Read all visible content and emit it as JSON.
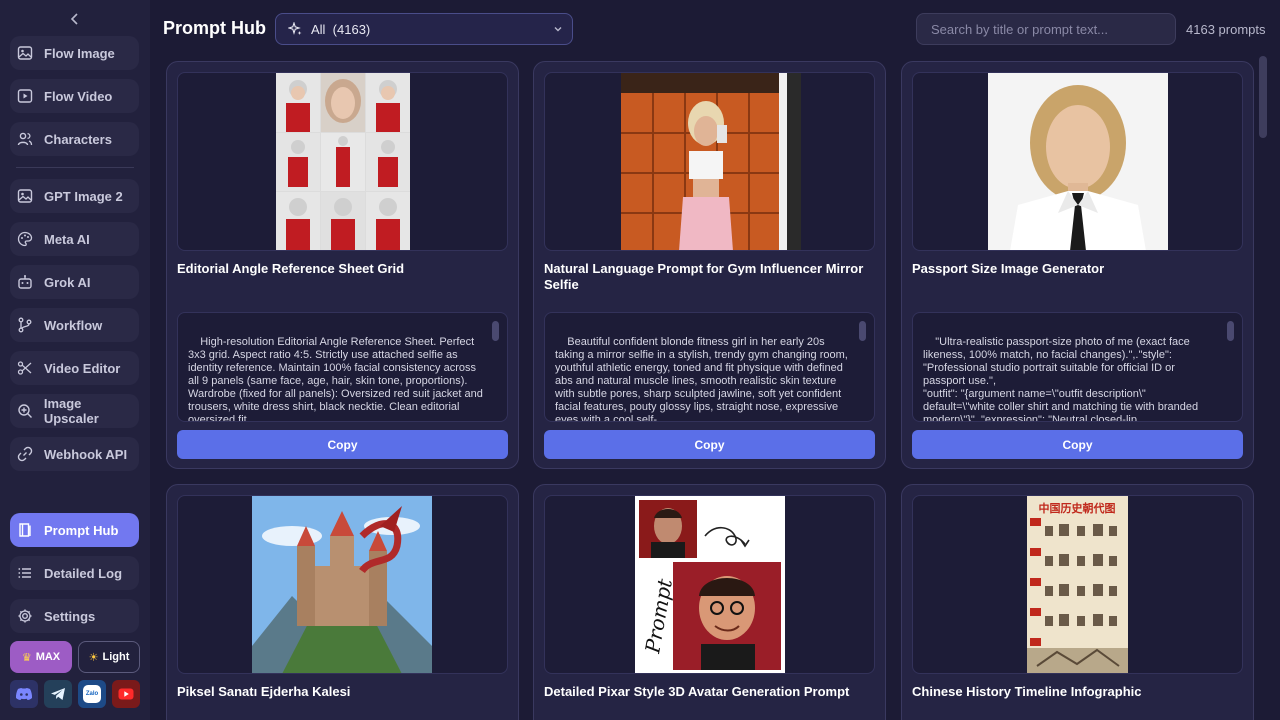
{
  "sidebar": {
    "items": [
      {
        "label": "Flow Image",
        "icon": "image-icon"
      },
      {
        "label": "Flow Video",
        "icon": "play-icon"
      },
      {
        "label": "Characters",
        "icon": "users-icon"
      },
      {
        "label": "GPT Image 2",
        "icon": "image-icon"
      },
      {
        "label": "Meta AI",
        "icon": "palette-icon"
      },
      {
        "label": "Grok AI",
        "icon": "bot-icon"
      },
      {
        "label": "Workflow",
        "icon": "workflow-icon"
      },
      {
        "label": "Video Editor",
        "icon": "scissors-icon"
      },
      {
        "label": "Image Upscaler",
        "icon": "zoom-in-icon"
      },
      {
        "label": "Webhook API",
        "icon": "link-icon"
      }
    ],
    "bottom_items": [
      {
        "label": "Prompt Hub",
        "icon": "book-icon",
        "active": true
      },
      {
        "label": "Detailed Log",
        "icon": "list-icon"
      },
      {
        "label": "Settings",
        "icon": "gear-icon"
      }
    ],
    "max_label": "MAX",
    "theme_label": "Light",
    "socials": [
      "discord-icon",
      "telegram-icon",
      "zalo-icon",
      "youtube-icon"
    ],
    "active_color": "#7278f0"
  },
  "header": {
    "title": "Prompt Hub",
    "filter_value": "All  (4163)",
    "search_placeholder": "Search by title or prompt text...",
    "count": "4163 prompts"
  },
  "cards": [
    {
      "title": "Editorial Angle Reference Sheet Grid",
      "prompt": "High-resolution Editorial Angle Reference Sheet. Perfect 3x3 grid. Aspect ratio 4:5. Strictly use attached selfie as identity reference. Maintain 100% facial consistency across all 9 panels (same face, age, hair, skin tone, proportions). Wardrobe (fixed for all panels): Oversized red suit jacket and trousers, white dress shirt, black necktie. Clean editorial oversized fit.",
      "copy_label": "Copy"
    },
    {
      "title": "Natural Language Prompt for Gym Influencer Mirror Selfie",
      "prompt": "Beautiful confident blonde fitness girl in her early 20s taking a mirror selfie in a stylish, trendy gym changing room, youthful athletic energy, toned and fit physique with defined abs and natural muscle lines, smooth realistic skin texture with subtle pores, sharp sculpted jawline, soft yet confident facial features, pouty glossy lips, straight nose, expressive eyes with a cool self-",
      "copy_label": "Copy"
    },
    {
      "title": "Passport Size Image Generator",
      "prompt": "\"Ultra-realistic passport-size photo of me (exact face likeness, 100% match, no facial changes).\",.\"style\": \"Professional studio portrait suitable for official ID or passport use.\",\n\"outfit\": \"{argument name=\\\"outfit description\\\" default=\\\"white coller shirt and matching tie with branded modern\\\"}\", \"expression\": \"Neutral closed-lip",
      "copy_label": "Copy"
    },
    {
      "title": "Piksel Sanatı Ejderha Kalesi"
    },
    {
      "title": "Detailed Pixar Style 3D Avatar Generation Prompt",
      "image_text": "Prompt"
    },
    {
      "title": "Chinese History Timeline Infographic",
      "image_text": "中国历史朝代图"
    }
  ]
}
